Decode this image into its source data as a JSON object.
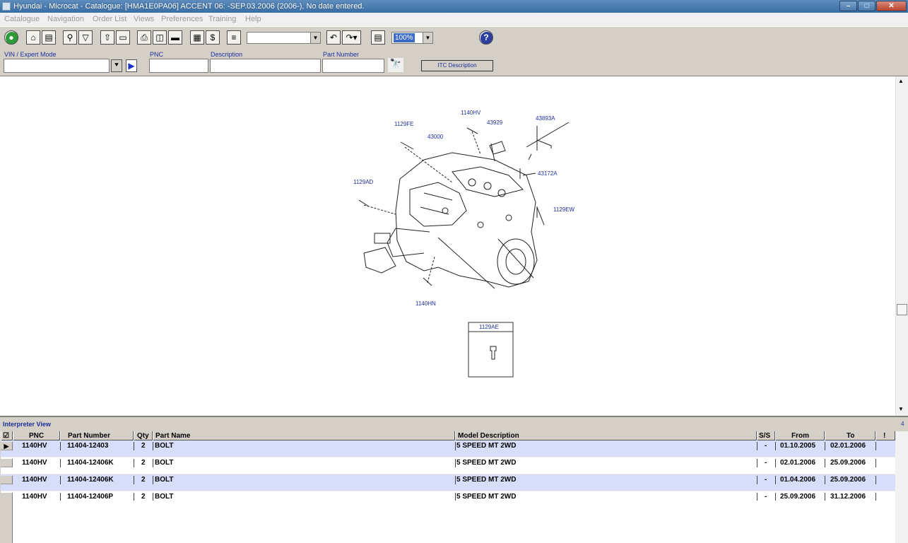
{
  "window": {
    "title": "Hyundai - Microcat - Catalogue: [HMA1E0PA06] ACCENT 06: -SEP.03.2006 (2006-), No date entered."
  },
  "menu": [
    "Catalogue",
    "Navigation",
    "Order List",
    "Views",
    "Preferences",
    "Training",
    "Help"
  ],
  "toolbar": {
    "zoom": "100%",
    "icons": [
      "exit-icon",
      "home-icon",
      "catalogue-icon",
      "search-icon",
      "filter-icon",
      "info-icon",
      "screen-icon",
      "print-icon",
      "preview-icon",
      "note-icon",
      "list-icon",
      "price-icon",
      "order-icon",
      "undo-icon",
      "redo-icon",
      "bookmark-icon",
      "help-icon"
    ]
  },
  "search": {
    "vin_label": "VIN / Expert Mode",
    "pnc_label": "PNC",
    "description_label": "Description",
    "part_number_label": "Part Number",
    "itc_button": "ITC Description"
  },
  "diagram": {
    "callouts": [
      "1140HV",
      "1129FE",
      "43000",
      "43929",
      "43893A",
      "1129AD",
      "43172A",
      "1129EW",
      "1140HN",
      "1129AE"
    ]
  },
  "interpreter": {
    "title": "Interpreter View",
    "count": "4",
    "columns": [
      "PNC",
      "Part Number",
      "Qty",
      "Part Name",
      "Model Description",
      "S/S",
      "From",
      "To",
      "!"
    ],
    "rows": [
      {
        "pnc": "1140HV",
        "part_number": "11404-12403",
        "qty": "2",
        "part_name": "BOLT",
        "model": "5 SPEED MT 2WD",
        "ss": "-",
        "from": "01.10.2005",
        "to": "02.01.2006",
        "current": true
      },
      {
        "pnc": "1140HV",
        "part_number": "11404-12406K",
        "qty": "2",
        "part_name": "BOLT",
        "model": "5 SPEED MT 2WD",
        "ss": "-",
        "from": "02.01.2006",
        "to": "25.09.2006",
        "current": false
      },
      {
        "pnc": "1140HV",
        "part_number": "11404-12406K",
        "qty": "2",
        "part_name": "BOLT",
        "model": "5 SPEED MT 2WD",
        "ss": "-",
        "from": "01.04.2006",
        "to": "25.09.2006",
        "current": false
      },
      {
        "pnc": "1140HV",
        "part_number": "11404-12406P",
        "qty": "2",
        "part_name": "BOLT",
        "model": "5 SPEED MT 2WD",
        "ss": "-",
        "from": "25.09.2006",
        "to": "31.12.2006",
        "current": false
      }
    ]
  },
  "colors": {
    "titlebar": "#3a6ea5",
    "chrome": "#d4d0c8",
    "label_blue": "#1e2e9a",
    "row_highlight": "#d6defa"
  }
}
